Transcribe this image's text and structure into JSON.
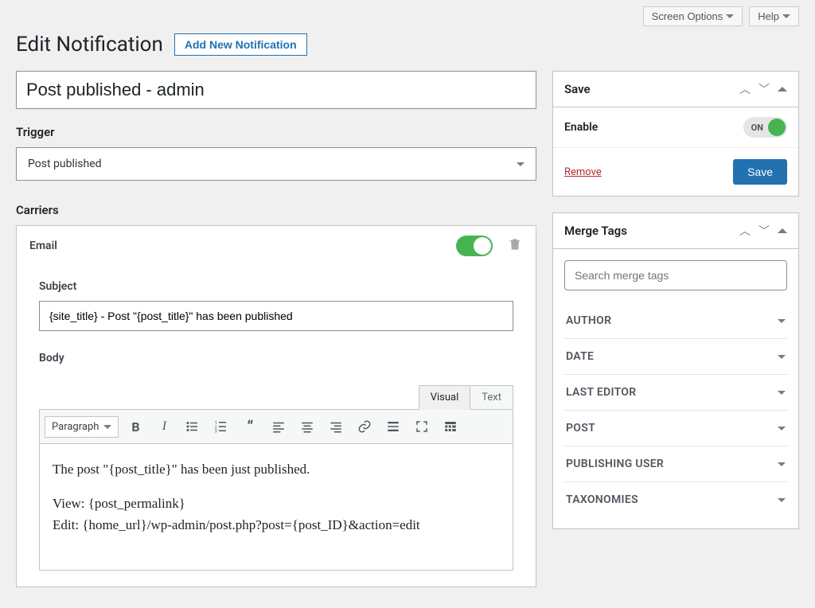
{
  "top": {
    "screen_options": "Screen Options",
    "help": "Help"
  },
  "header": {
    "title": "Edit Notification",
    "add_new": "Add New Notification"
  },
  "notification_title": "Post published - admin",
  "trigger": {
    "heading": "Trigger",
    "selected": "Post published"
  },
  "carriers": {
    "heading": "Carriers",
    "email": {
      "name": "Email",
      "subject_label": "Subject",
      "subject_value": "{site_title} - Post \"{post_title}\" has been published",
      "body_label": "Body",
      "tabs": {
        "visual": "Visual",
        "text": "Text"
      },
      "format": "Paragraph",
      "body_p1": "The post \"{post_title}\" has been just published.",
      "body_p2a": "View: {post_permalink}",
      "body_p2b": "Edit: {home_url}/wp-admin/post.php?post={post_ID}&action=edit"
    }
  },
  "sidebar": {
    "save": {
      "title": "Save",
      "enable_label": "Enable",
      "toggle_text": "ON",
      "remove": "Remove",
      "save_btn": "Save"
    },
    "merge": {
      "title": "Merge Tags",
      "search_placeholder": "Search merge tags",
      "groups": [
        "AUTHOR",
        "DATE",
        "LAST EDITOR",
        "POST",
        "PUBLISHING USER",
        "TAXONOMIES"
      ]
    }
  }
}
